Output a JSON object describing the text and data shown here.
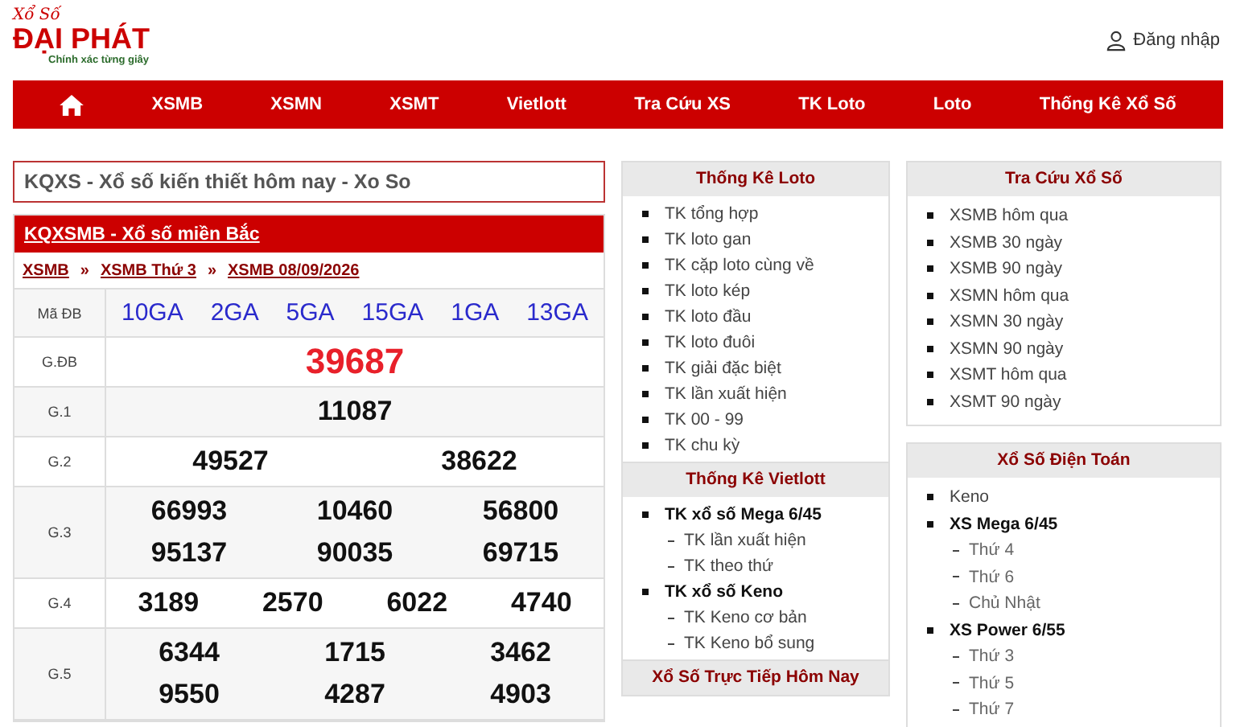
{
  "logo": {
    "script": "Xổ Số",
    "name": "ĐẠI PHÁT",
    "tagline": "Chính xác từng giây"
  },
  "login": "Đăng nhập",
  "nav": [
    {
      "kind": "home"
    },
    {
      "kind": "text",
      "label": "XSMB"
    },
    {
      "kind": "text",
      "label": "XSMN"
    },
    {
      "kind": "text",
      "label": "XSMT"
    },
    {
      "kind": "text",
      "label": "Vietlott"
    },
    {
      "kind": "text",
      "label": "Tra Cứu XS"
    },
    {
      "kind": "text",
      "label": "TK Loto"
    },
    {
      "kind": "text",
      "label": "Loto"
    },
    {
      "kind": "text",
      "label": "Thống Kê Xổ Số"
    }
  ],
  "page_title": "KQXS - Xổ số kiến thiết hôm nay - Xo So",
  "results": {
    "title": "KQXSMB - Xổ số miền Bắc",
    "breadcrumb": [
      "XSMB",
      "XSMB Thứ 3",
      "XSMB 08/09/2026"
    ],
    "separator": "»",
    "code_label": "Mã ĐB",
    "codes": [
      "10GA",
      "2GA",
      "5GA",
      "15GA",
      "1GA",
      "13GA"
    ],
    "prizes": [
      {
        "label": "G.ĐB",
        "special": true,
        "lines": [
          [
            "39687"
          ]
        ]
      },
      {
        "label": "G.1",
        "special": false,
        "lines": [
          [
            "11087"
          ]
        ]
      },
      {
        "label": "G.2",
        "special": false,
        "lines": [
          [
            "49527",
            "38622"
          ]
        ]
      },
      {
        "label": "G.3",
        "special": false,
        "lines": [
          [
            "66993",
            "10460",
            "56800"
          ],
          [
            "95137",
            "90035",
            "69715"
          ]
        ]
      },
      {
        "label": "G.4",
        "special": false,
        "lines": [
          [
            "3189",
            "2570",
            "6022",
            "4740"
          ]
        ]
      },
      {
        "label": "G.5",
        "special": false,
        "lines": [
          [
            "6344",
            "1715",
            "3462"
          ],
          [
            "9550",
            "4287",
            "4903"
          ]
        ]
      }
    ]
  },
  "middle": [
    {
      "title": "Thống Kê Loto",
      "items": [
        {
          "label": "TK tổng hợp"
        },
        {
          "label": "TK loto gan"
        },
        {
          "label": "TK cặp loto cùng về"
        },
        {
          "label": "TK loto kép"
        },
        {
          "label": "TK loto đầu"
        },
        {
          "label": "TK loto đuôi"
        },
        {
          "label": "TK giải đặc biệt"
        },
        {
          "label": "TK lần xuất hiện"
        },
        {
          "label": "TK 00 - 99"
        },
        {
          "label": "TK chu kỳ"
        }
      ]
    },
    {
      "title": "Thống Kê Vietlott",
      "items": [
        {
          "label": "TK xổ số Mega 6/45",
          "children": [
            {
              "label": "TK lần xuất hiện"
            },
            {
              "label": "TK theo thứ"
            }
          ]
        },
        {
          "label": "TK xổ số Keno",
          "children": [
            {
              "label": "TK Keno cơ bản"
            },
            {
              "label": "TK Keno bổ sung"
            }
          ]
        }
      ]
    },
    {
      "title": "Xổ Số Trực Tiếp Hôm Nay"
    }
  ],
  "right": [
    {
      "title": "Tra Cứu Xổ Số",
      "items": [
        {
          "label": "XSMB hôm qua"
        },
        {
          "label": "XSMB 30 ngày"
        },
        {
          "label": "XSMB 90 ngày"
        },
        {
          "label": "XSMN hôm qua"
        },
        {
          "label": "XSMN 30 ngày"
        },
        {
          "label": "XSMN 90 ngày"
        },
        {
          "label": "XSMT hôm qua"
        },
        {
          "label": "XSMT 90 ngày"
        }
      ]
    },
    {
      "title": "Xổ Số Điện Toán",
      "items": [
        {
          "label": "Keno"
        },
        {
          "label": "XS Mega 6/45",
          "children": [
            {
              "label": "Thứ 4"
            },
            {
              "label": "Thứ 6"
            },
            {
              "label": "Chủ Nhật"
            }
          ]
        },
        {
          "label": "XS Power 6/55",
          "children": [
            {
              "label": "Thứ 3"
            },
            {
              "label": "Thứ 5"
            },
            {
              "label": "Thứ 7"
            }
          ]
        }
      ]
    }
  ]
}
